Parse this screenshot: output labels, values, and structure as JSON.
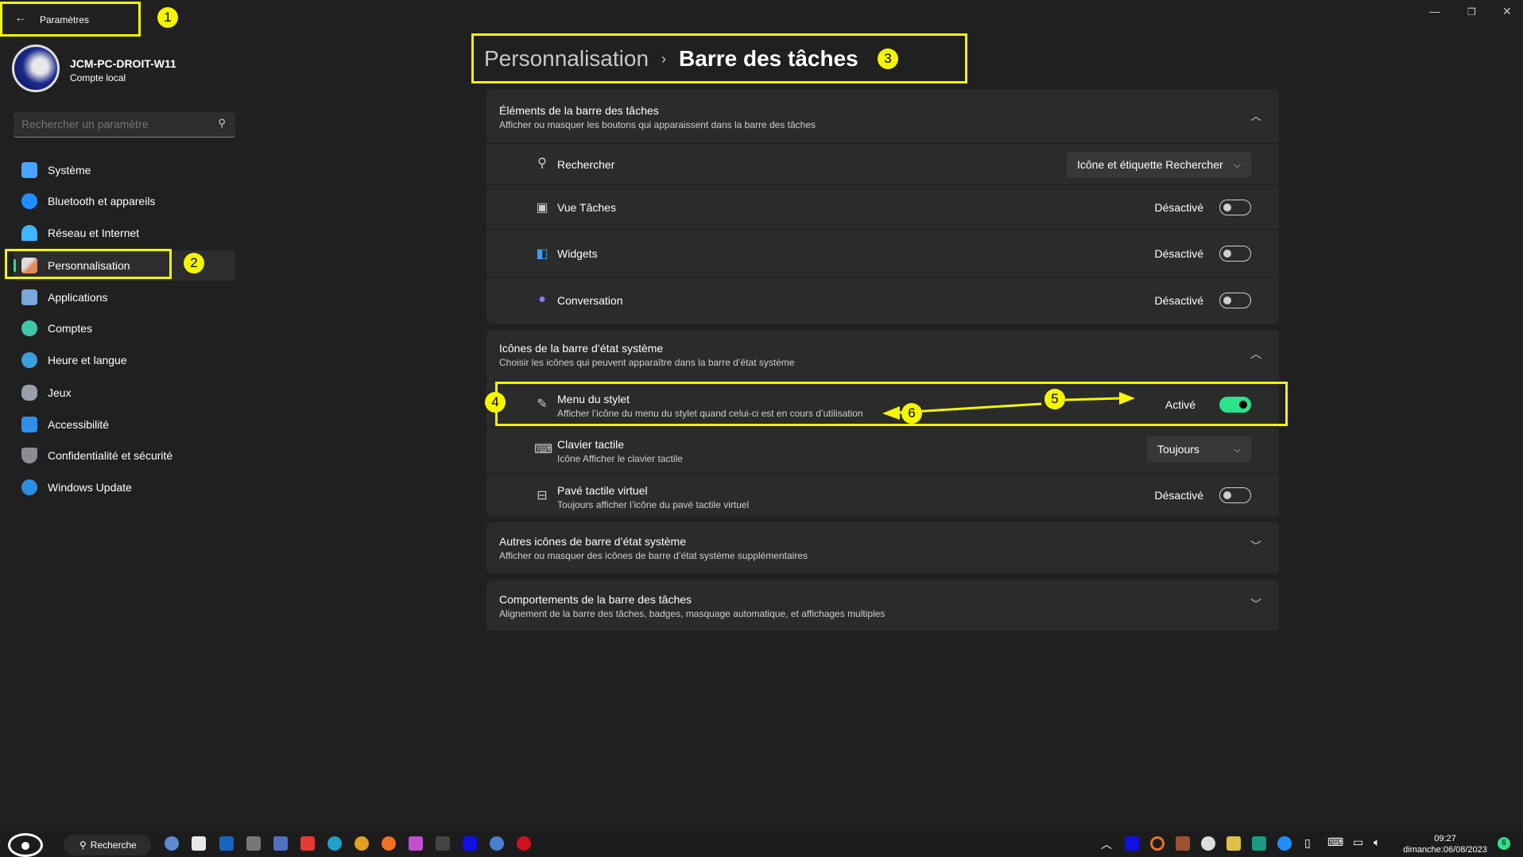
{
  "window": {
    "title": "Paramètres",
    "controls": [
      "minimize",
      "restore",
      "close"
    ]
  },
  "user": {
    "name": "JCM-PC-DROIT-W11",
    "account": "Compte local"
  },
  "search": {
    "placeholder": "Rechercher un paramètre"
  },
  "sidebar": {
    "items": [
      {
        "label": "Système",
        "color": "#4aa3ff"
      },
      {
        "label": "Bluetooth et appareils",
        "color": "#1f8fff"
      },
      {
        "label": "Réseau et Internet",
        "color": "#3fb6ff"
      },
      {
        "label": "Personnalisation",
        "color": "#e08a5a",
        "selected": true
      },
      {
        "label": "Applications",
        "color": "#7aa7d8"
      },
      {
        "label": "Comptes",
        "color": "#3fc8a8"
      },
      {
        "label": "Heure et langue",
        "color": "#3aa0e0"
      },
      {
        "label": "Jeux",
        "color": "#9aa0a8"
      },
      {
        "label": "Accessibilité",
        "color": "#2f8fe8"
      },
      {
        "label": "Confidentialité et sécurité",
        "color": "#8c8c95"
      },
      {
        "label": "Windows Update",
        "color": "#2a8fe0"
      }
    ]
  },
  "breadcrumb": {
    "parent": "Personnalisation",
    "current": "Barre des tâches"
  },
  "sections": [
    {
      "title": "Éléments de la barre des tâches",
      "subtitle": "Afficher ou masquer les boutons qui apparaissent dans la barre des tâches",
      "expanded": true,
      "rows": [
        {
          "label": "Rechercher",
          "control": "dropdown",
          "value": "Icône et étiquette Rechercher"
        },
        {
          "label": "Vue Tâches",
          "control": "toggle",
          "state": "Désactivé",
          "on": false
        },
        {
          "label": "Widgets",
          "control": "toggle",
          "state": "Désactivé",
          "on": false
        },
        {
          "label": "Conversation",
          "control": "toggle",
          "state": "Désactivé",
          "on": false
        }
      ]
    },
    {
      "title": "Icônes de la barre d’état système",
      "subtitle": "Choisir les icônes qui peuvent apparaître dans la barre d’état système",
      "expanded": true,
      "rows": [
        {
          "label": "Menu du stylet",
          "desc": "Afficher l’icône du menu du stylet quand celui-ci est en cours d’utilisation",
          "control": "toggle",
          "state": "Activé",
          "on": true
        },
        {
          "label": "Clavier tactile",
          "desc": "Icône Afficher le clavier tactile",
          "control": "dropdown",
          "value": "Toujours"
        },
        {
          "label": "Pavé tactile virtuel",
          "desc": "Toujours afficher l’icône du pavé tactile virtuel",
          "control": "toggle",
          "state": "Désactivé",
          "on": false
        }
      ]
    },
    {
      "title": "Autres icônes de barre d’état système",
      "subtitle": "Afficher ou masquer des icônes de barre d’état système supplémentaires",
      "expanded": false
    },
    {
      "title": "Comportements de la barre des tâches",
      "subtitle": "Alignement de la barre des tâches, badges, masquage automatique, et affichages multiples",
      "expanded": false
    }
  ],
  "annotations": [
    "1",
    "2",
    "3",
    "4",
    "5",
    "6"
  ],
  "taskbar": {
    "search_label": "Recherche",
    "time": "09:27",
    "date": "dimanche:06/08/2023",
    "notification_count": "6"
  },
  "accent": "#2be38a"
}
